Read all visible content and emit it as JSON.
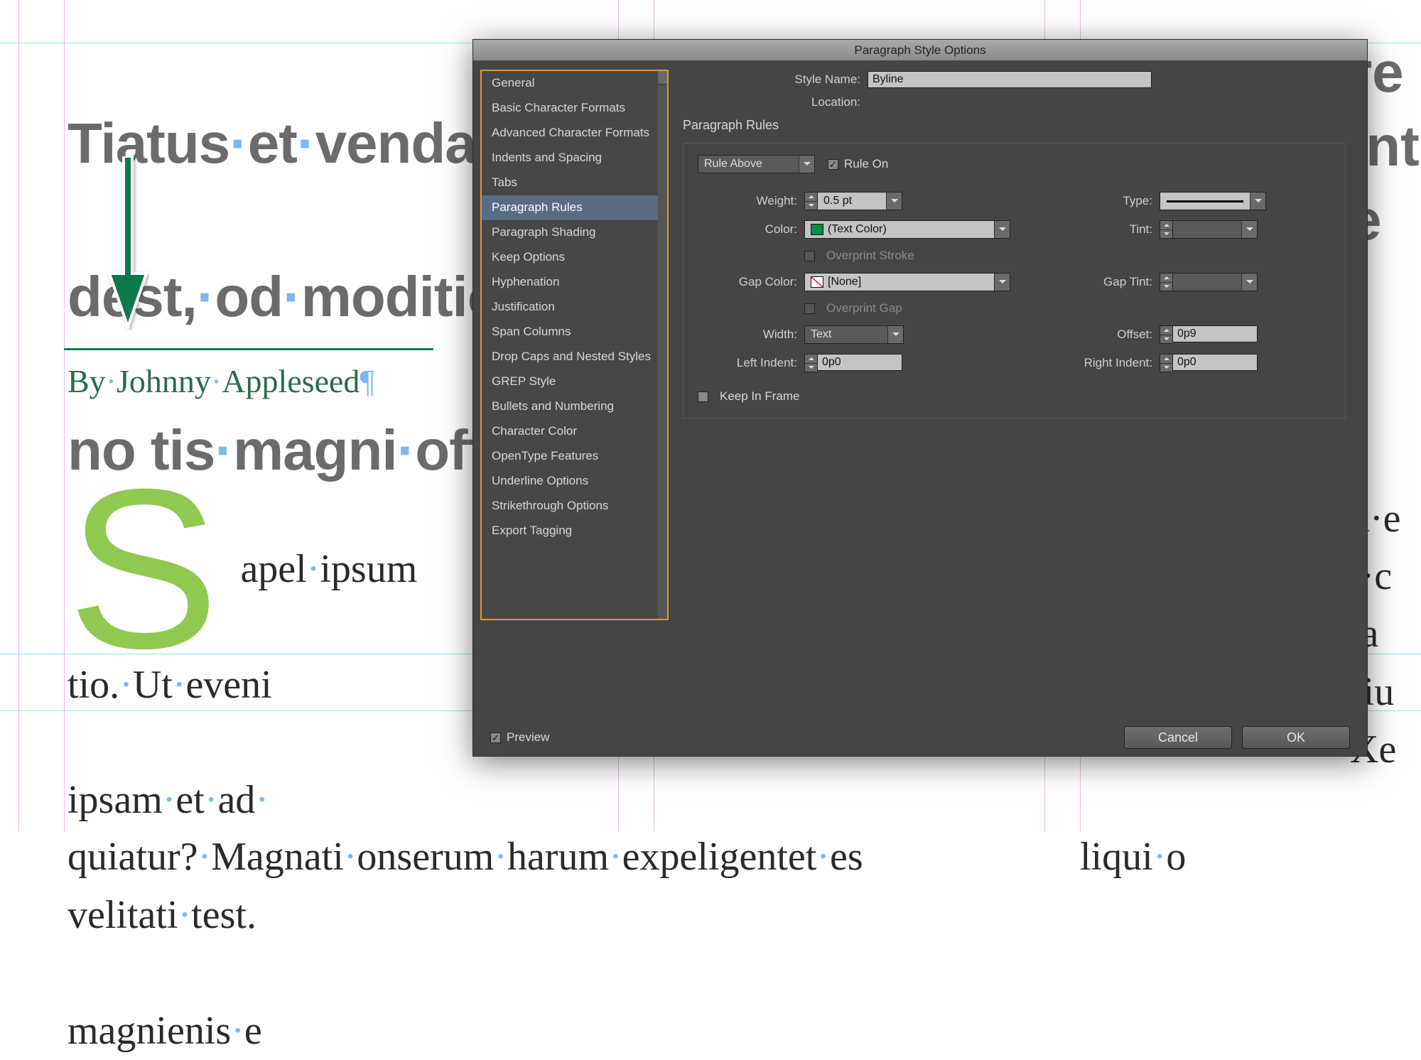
{
  "doc": {
    "headline_l1": "Tiatus·et·vendae·co",
    "headline_l2": "dest,·od·moditio·re",
    "headline_l3": "no   tis·magni·officip",
    "byline": "By·Johnny·Appleseed",
    "right_head1": "re",
    "right_head2": "int",
    "right_head3": "e",
    "dropcap": "S",
    "body_l1": "apel·ipsum",
    "body_l2": "tio.·Ut·eveni",
    "body_l3": "ipsam·et·ad·",
    "body_l4": "velitati·test.",
    "body_l5": "magnienis·e",
    "body_last": "quiatur?·Magnati·onserum·harum·expeligentet·es",
    "right_body1": "n·e",
    "right_body2": "i·c",
    "right_body3": "la",
    "right_body4": "·iu",
    "right_body5": "Xe",
    "right_body_last": "liqui·o"
  },
  "dialog": {
    "title": "Paragraph Style Options",
    "style_name_label": "Style Name:",
    "style_name_value": "Byline",
    "location_label": "Location:",
    "panel_title": "Paragraph Rules",
    "rule_selector": "Rule Above",
    "rule_on_label": "Rule On",
    "rule_on_checked": true,
    "fields": {
      "weight_label": "Weight:",
      "weight_value": "0.5 pt",
      "type_label": "Type:",
      "color_label": "Color:",
      "color_value": "(Text Color)",
      "tint_label": "Tint:",
      "overprint_stroke": "Overprint Stroke",
      "gap_color_label": "Gap Color:",
      "gap_color_value": "[None]",
      "gap_tint_label": "Gap Tint:",
      "overprint_gap": "Overprint Gap",
      "width_label": "Width:",
      "width_value": "Text",
      "offset_label": "Offset:",
      "offset_value": "0p9",
      "left_indent_label": "Left Indent:",
      "left_indent_value": "0p0",
      "right_indent_label": "Right Indent:",
      "right_indent_value": "0p0",
      "keep_in_frame": "Keep In Frame"
    },
    "sidebar": [
      "General",
      "Basic Character Formats",
      "Advanced Character Formats",
      "Indents and Spacing",
      "Tabs",
      "Paragraph Rules",
      "Paragraph Shading",
      "Keep Options",
      "Hyphenation",
      "Justification",
      "Span Columns",
      "Drop Caps and Nested Styles",
      "GREP Style",
      "Bullets and Numbering",
      "Character Color",
      "OpenType Features",
      "Underline Options",
      "Strikethrough Options",
      "Export Tagging"
    ],
    "sidebar_selected": "Paragraph Rules",
    "footer": {
      "preview_label": "Preview",
      "preview_checked": true,
      "cancel": "Cancel",
      "ok": "OK"
    }
  }
}
